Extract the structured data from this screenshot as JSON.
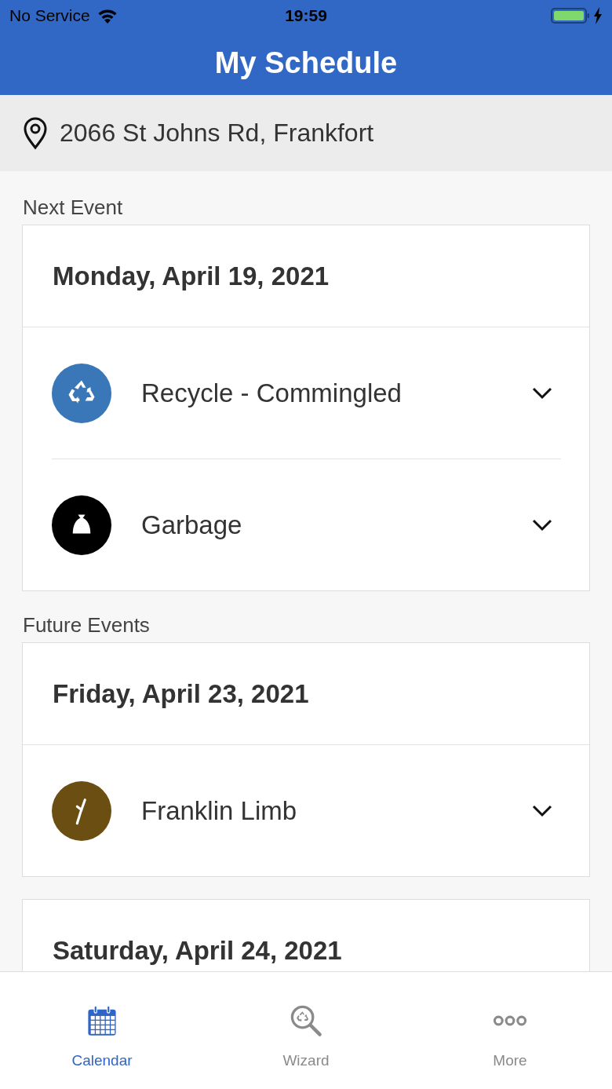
{
  "status_bar": {
    "carrier": "No Service",
    "time": "19:59"
  },
  "header": {
    "title": "My Schedule"
  },
  "address": "2066 St Johns Rd, Frankfort",
  "sections": [
    {
      "label": "Next Event",
      "days": [
        {
          "date": "Monday, April 19, 2021",
          "events": [
            {
              "kind": "recycle",
              "name": "Recycle - Commingled",
              "color": "#3a77b8",
              "expanded": false
            },
            {
              "kind": "garbage",
              "name": "Garbage",
              "color": "#000000",
              "expanded": false
            }
          ]
        }
      ]
    },
    {
      "label": "Future Events",
      "days": [
        {
          "date": "Friday, April 23, 2021",
          "events": [
            {
              "kind": "branch",
              "name": "Franklin Limb",
              "color": "#6b4e12",
              "expanded": false
            }
          ]
        },
        {
          "date": "Saturday, April 24, 2021"
        }
      ]
    }
  ],
  "tabs": [
    {
      "kind": "calendar",
      "label": "Calendar",
      "selected": true
    },
    {
      "kind": "wizard",
      "label": "Wizard",
      "selected": false
    },
    {
      "kind": "more",
      "label": "More",
      "selected": false
    }
  ]
}
